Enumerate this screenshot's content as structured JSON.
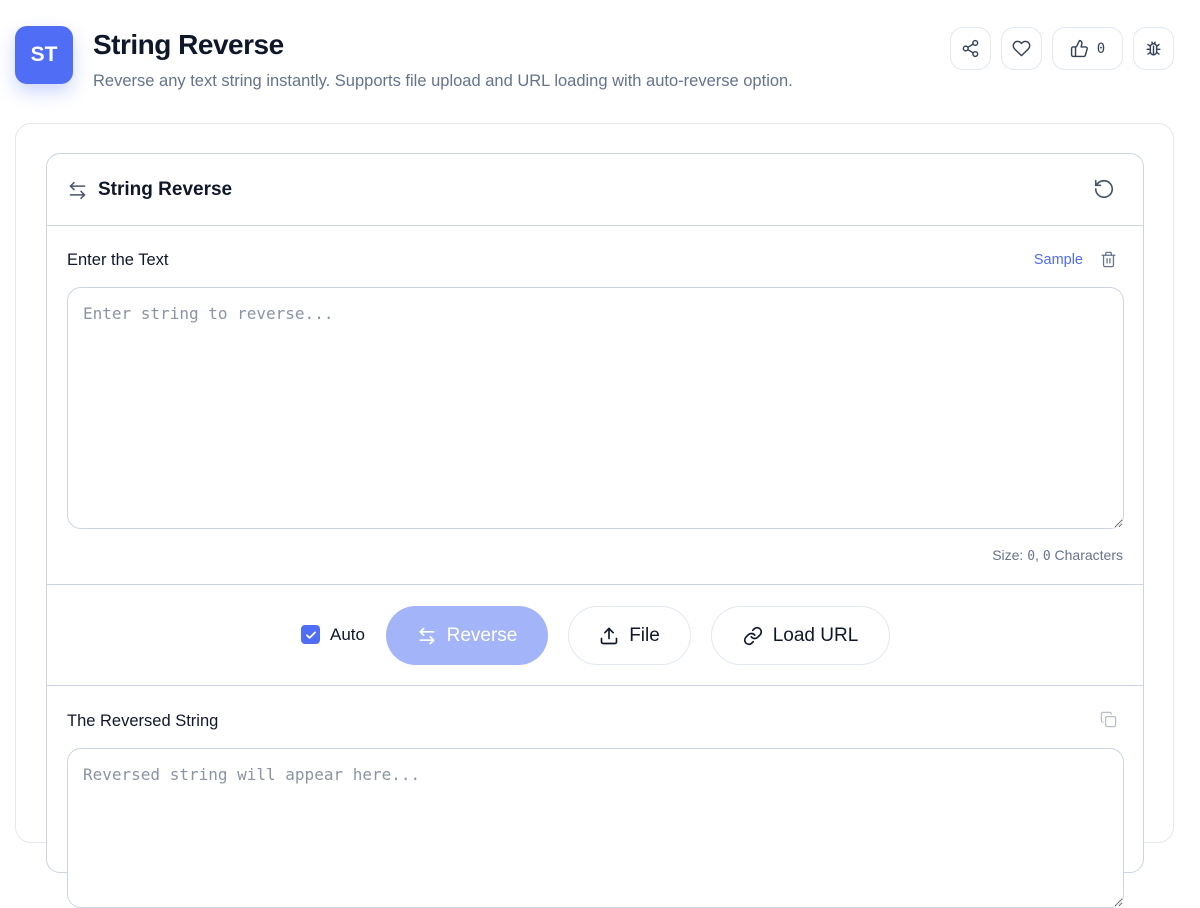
{
  "header": {
    "logo_text": "ST",
    "title": "String Reverse",
    "subtitle": "Reverse any text string instantly. Supports file upload and URL loading with auto-reverse option.",
    "like_count": "0",
    "icons": [
      "share-icon",
      "heart-icon",
      "thumbs-up-icon",
      "bug-icon"
    ]
  },
  "card": {
    "title": "String Reverse",
    "title_icon": "swap-arrows-icon",
    "reset_icon": "reset-icon"
  },
  "input": {
    "label": "Enter the Text",
    "sample_label": "Sample",
    "placeholder": "Enter string to reverse...",
    "value": "",
    "size_label": "Size:",
    "size_value": "0",
    "chars_value": "0",
    "chars_label": "Characters"
  },
  "actions": {
    "auto_label": "Auto",
    "auto_checked": true,
    "reverse_label": "Reverse",
    "file_label": "File",
    "load_url_label": "Load URL"
  },
  "output": {
    "label": "The Reversed String",
    "placeholder": "Reversed string will appear here...",
    "value": ""
  },
  "colors": {
    "accent": "#4f6df5",
    "accent_disabled": "#a3b4f9",
    "border": "#cbd5e1",
    "muted_text": "#64748b"
  }
}
